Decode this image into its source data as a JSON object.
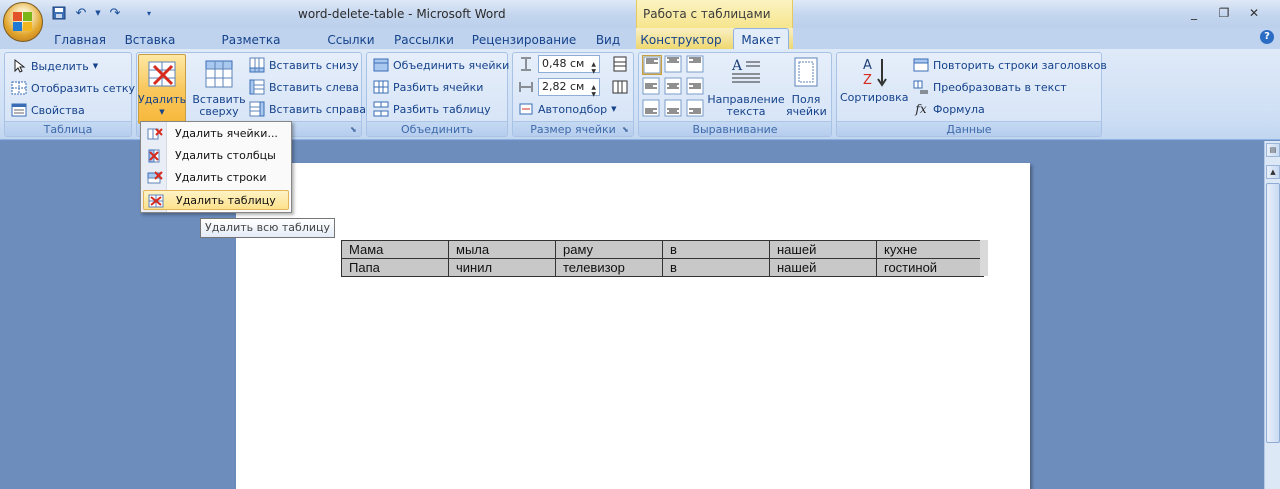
{
  "window": {
    "title": "word-delete-table  -  Microsoft Word",
    "contextual_group": "Работа с таблицами"
  },
  "tabs": [
    "Главная",
    "Вставка",
    "Разметка страницы",
    "Ссылки",
    "Рассылки",
    "Рецензирование",
    "Вид",
    "Конструктор",
    "Макет"
  ],
  "active_tab": "Макет",
  "ribbon": {
    "table_group": {
      "label": "Таблица",
      "select": "Выделить",
      "gridlines": "Отобразить сетку",
      "properties": "Свойства"
    },
    "rows_cols_group": {
      "delete": "Удалить",
      "insert_above_1": "Вставить",
      "insert_above_2": "сверху",
      "insert_below": "Вставить снизу",
      "insert_left": "Вставить слева",
      "insert_right": "Вставить справа"
    },
    "merge_group": {
      "label": "Объединить",
      "merge_cells": "Объединить ячейки",
      "split_cells": "Разбить ячейки",
      "split_table": "Разбить таблицу"
    },
    "cell_size_group": {
      "label": "Размер ячейки",
      "height": "0,48 см",
      "width": "2,82 см",
      "autofit": "Автоподбор"
    },
    "alignment_group": {
      "label": "Выравнивание",
      "text_direction_1": "Направление",
      "text_direction_2": "текста",
      "margins_1": "Поля",
      "margins_2": "ячейки"
    },
    "data_group": {
      "label": "Данные",
      "sort": "Сортировка",
      "repeat_header": "Повторить строки заголовков",
      "convert": "Преобразовать в текст",
      "formula": "Формула"
    }
  },
  "delete_menu": {
    "items": [
      "Удалить ячейки...",
      "Удалить столбцы",
      "Удалить строки",
      "Удалить таблицу"
    ],
    "highlighted": "Удалить таблицу",
    "tooltip": "Удалить всю таблицу"
  },
  "document_table": {
    "rows": [
      [
        "Мама",
        "мыла",
        "раму",
        "в",
        "нашей",
        "кухне"
      ],
      [
        "Папа",
        "чинил",
        "телевизор",
        "в",
        "нашей",
        "гостиной"
      ]
    ]
  },
  "colors": {
    "ribbon_bg": "#dfeaf8",
    "highlight": "#fde28c",
    "doc_bg": "#6d8dbd",
    "cell_bg": "#c8c8c8"
  }
}
